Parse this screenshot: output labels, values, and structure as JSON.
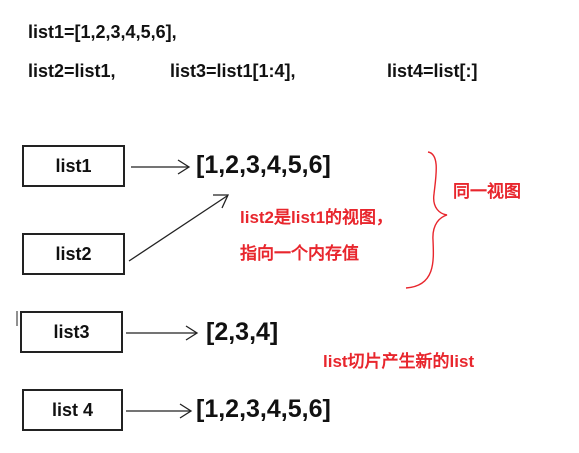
{
  "code_line_1": "list1=[1,2,3,4,5,6],",
  "code_line_2": {
    "a": "list2=list1,",
    "b": "list3=list1[1:4],",
    "c": "list4=list[:]"
  },
  "boxes": {
    "list1": "list1",
    "list2": "list2",
    "list3": "list3",
    "list4": "list 4"
  },
  "values": {
    "list1": "[1,2,3,4,5,6]",
    "list3": "[2,3,4]",
    "list4": "[1,2,3,4,5,6]"
  },
  "annotations": {
    "view_line_1": "list2是list1的视图，",
    "view_line_2": "指向一个内存值",
    "same_view": "同一视图",
    "slice_note": "list切片产生新的list"
  },
  "colors": {
    "annotation": "#e8262d",
    "text": "#111111"
  }
}
